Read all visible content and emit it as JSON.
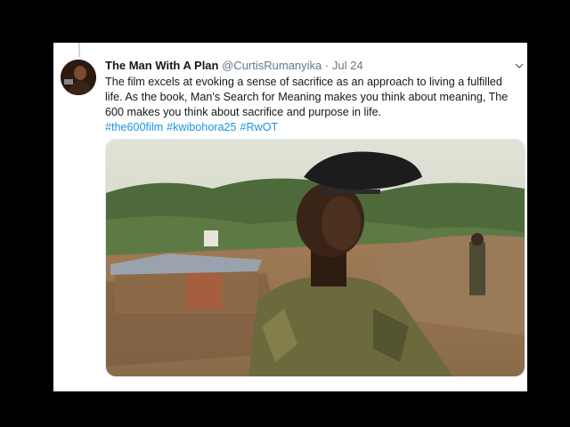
{
  "tweet": {
    "author_name": "The Man With A Plan",
    "handle": "@CurtisRumanyika",
    "separator": "·",
    "date": "Jul 24",
    "text": "The film excels at evoking a sense of sacrifice as an approach to living a fulfilled life. As the book, Man's Search for Meaning makes you think about meaning, The 600 makes you think about sacrifice and purpose in life.",
    "hashtags": [
      "#the600film",
      "#kwibohora25",
      "#RwOT"
    ]
  },
  "icons": {
    "more": "chevron-down-icon",
    "avatar": "avatar-image"
  },
  "colors": {
    "background": "#000000",
    "card": "#ffffff",
    "text": "#14171a",
    "muted": "#657786",
    "link": "#1b95e0"
  }
}
